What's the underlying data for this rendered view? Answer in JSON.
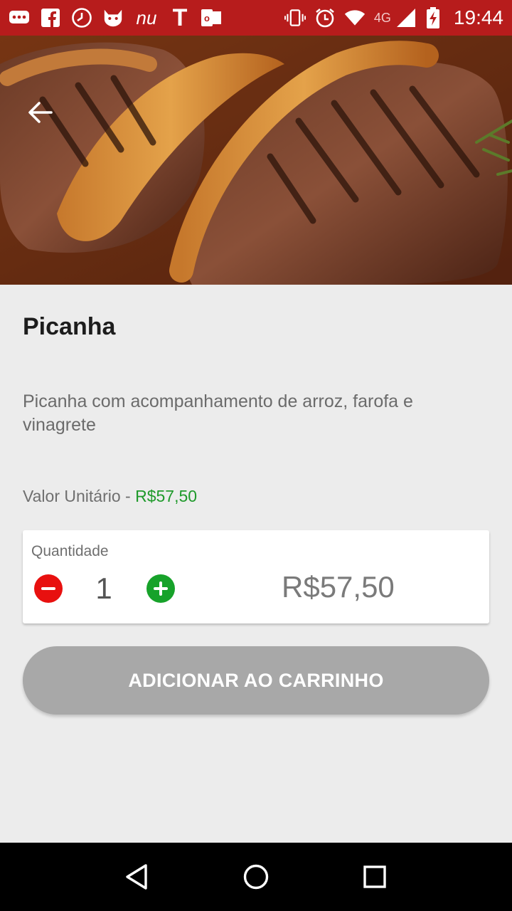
{
  "status_bar": {
    "time": "19:44",
    "network": "4G",
    "icons": [
      "message-icon",
      "facebook-icon",
      "clock-icon",
      "cat-icon",
      "nu-icon",
      "t-icon",
      "outlook-icon",
      "vibrate-icon",
      "alarm-icon",
      "wifi-icon",
      "signal-icon",
      "battery-charging-icon"
    ],
    "nu_label": "nu",
    "t_label": "T",
    "outlook_label": "o"
  },
  "hero": {
    "back_icon": "arrow-left-icon"
  },
  "product": {
    "title": "Picanha",
    "description": "Picanha com acompanhamento de arroz, farofa e vinagrete",
    "unit_price_label": "Valor Unitário - ",
    "unit_price_value": "R$57,50"
  },
  "quantity": {
    "label": "Quantidade",
    "value": "1",
    "total": "R$57,50"
  },
  "actions": {
    "add_to_cart_label": "ADICIONAR AO CARRINHO"
  },
  "colors": {
    "status_bar": "#b71c1c",
    "minus_button": "#e8100f",
    "plus_button": "#17a22a",
    "unit_price": "#1f9a2b",
    "disabled_button": "#a8a8a8"
  }
}
